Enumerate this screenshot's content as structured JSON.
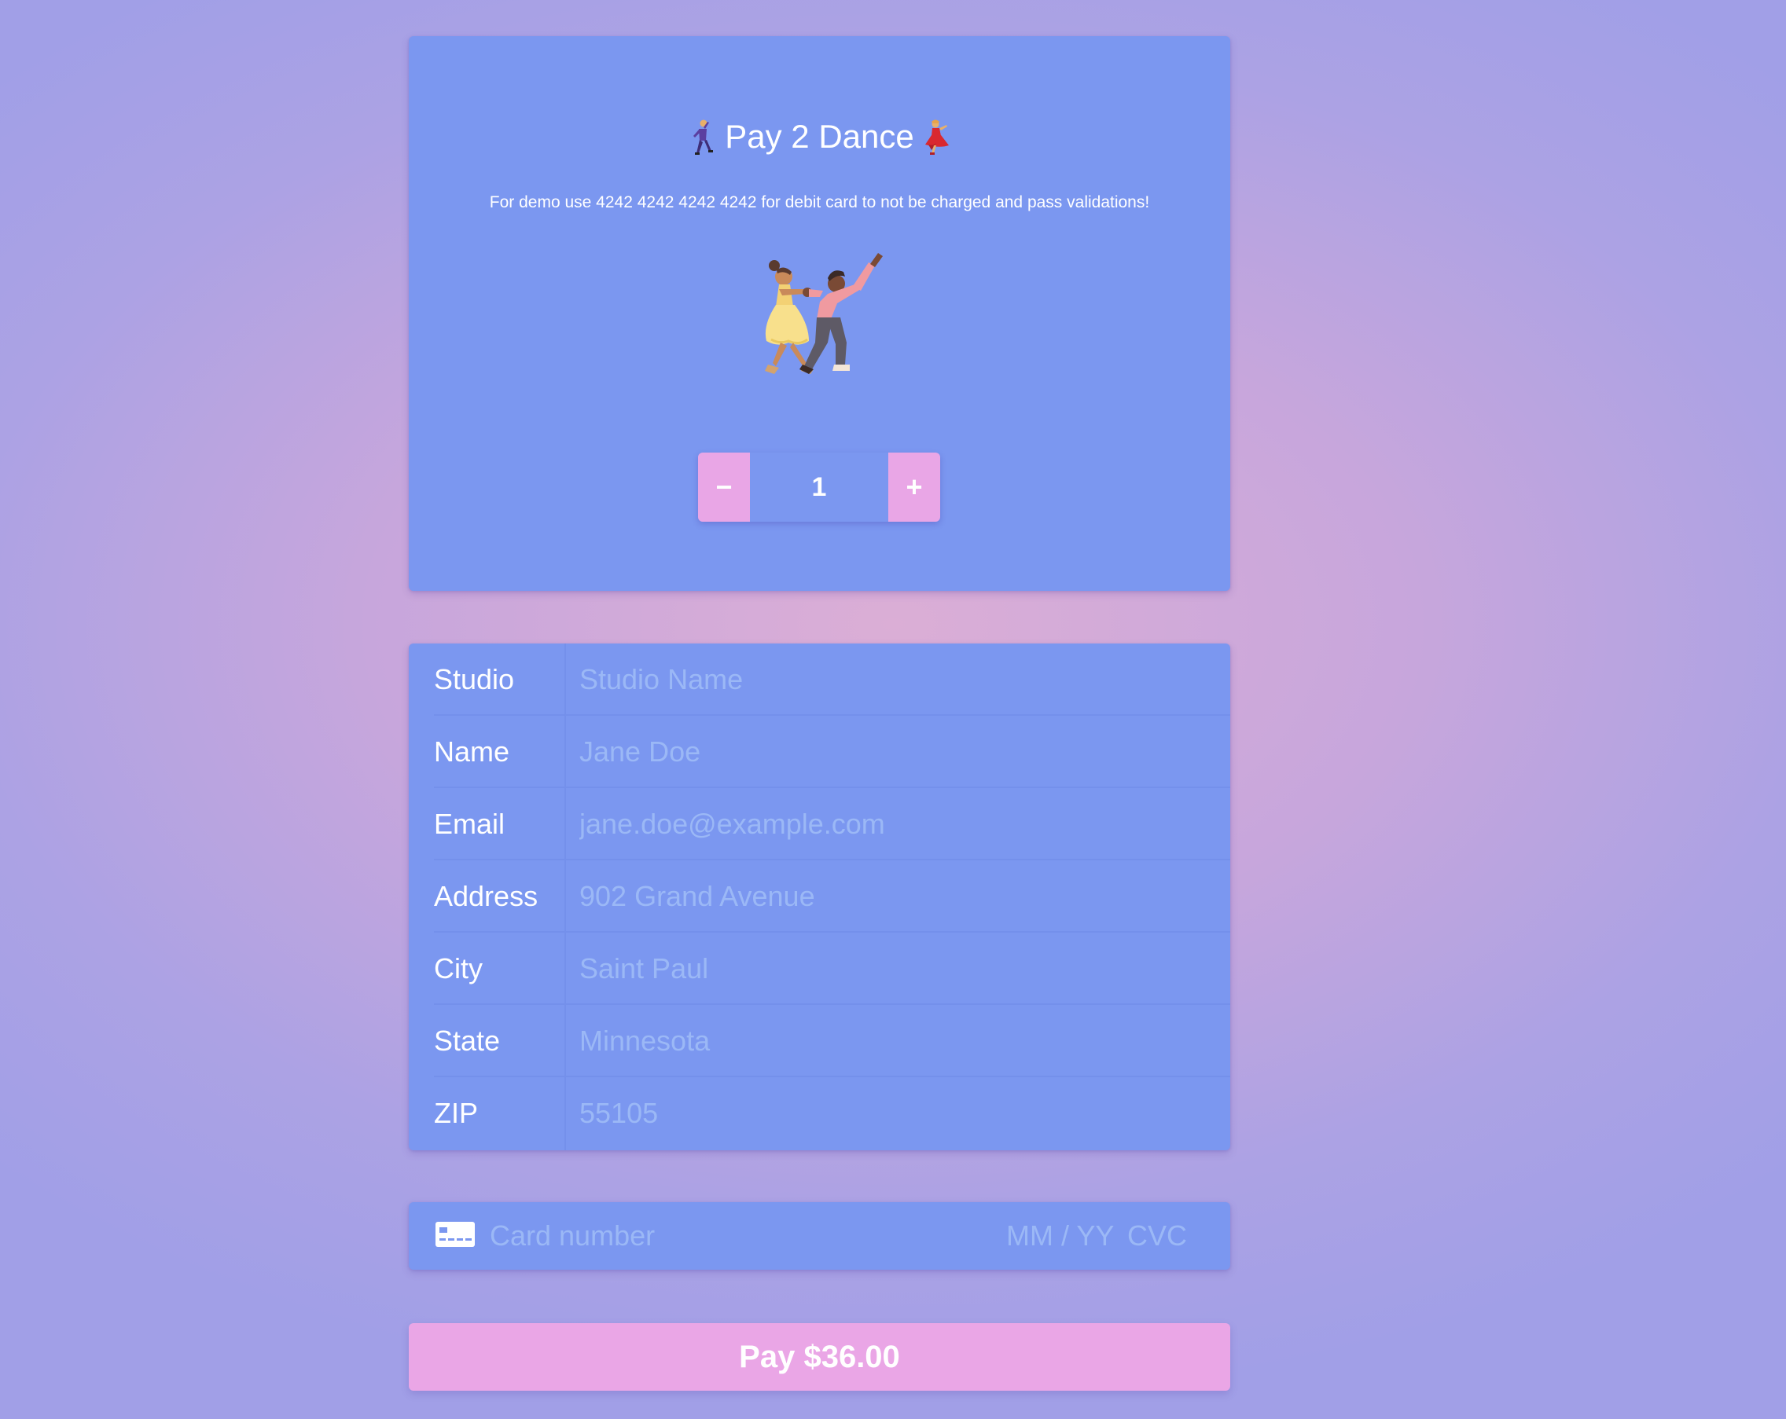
{
  "header": {
    "title": "Pay 2 Dance",
    "title_left_icon": "man-dancing-icon",
    "title_right_icon": "woman-dancing-icon",
    "demo_note": "For demo use 4242 4242 4242 4242 for debit card to not be charged and pass validations!",
    "illustration": "dancing-couple-illustration"
  },
  "quantity": {
    "decrement_label": "−",
    "value": "1",
    "increment_label": "+"
  },
  "form": {
    "fields": [
      {
        "label": "Studio",
        "placeholder": "Studio Name"
      },
      {
        "label": "Name",
        "placeholder": "Jane Doe"
      },
      {
        "label": "Email",
        "placeholder": "jane.doe@example.com"
      },
      {
        "label": "Address",
        "placeholder": "902 Grand Avenue"
      },
      {
        "label": "City",
        "placeholder": "Saint Paul"
      },
      {
        "label": "State",
        "placeholder": "Minnesota"
      },
      {
        "label": "ZIP",
        "placeholder": "55105"
      }
    ]
  },
  "card": {
    "icon": "credit-card-icon",
    "number_placeholder": "Card number",
    "expiry_placeholder": "MM / YY",
    "cvc_placeholder": "CVC"
  },
  "pay_button": {
    "label": "Pay $36.00"
  },
  "colors": {
    "panel": "#7b97f0",
    "accent": "#eaa6e6",
    "placeholder": "#9bb8f6",
    "text": "#ffffff"
  }
}
